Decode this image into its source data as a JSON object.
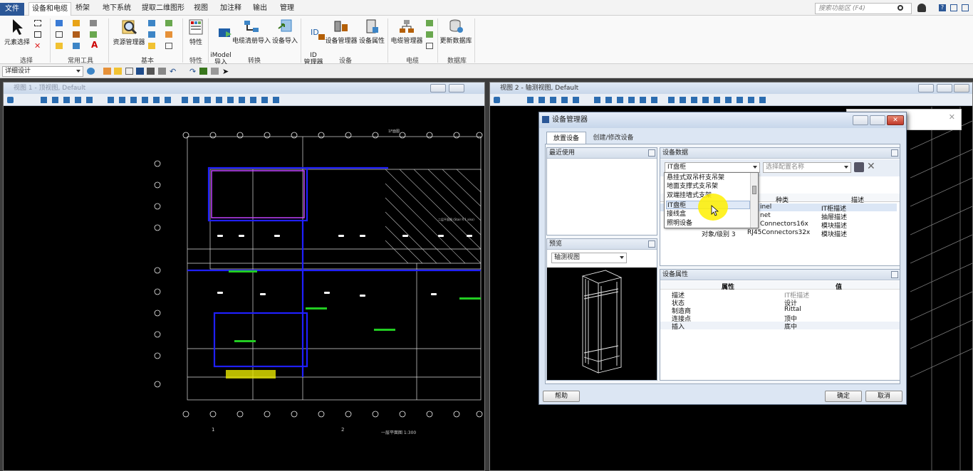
{
  "menubar": {
    "file": "文件",
    "tabs": [
      "设备和电缆",
      "桥架",
      "地下系统",
      "提取二维图形",
      "视图",
      "加注释",
      "输出",
      "管理"
    ],
    "search_placeholder": "搜索功能区 (F4)"
  },
  "ribbon": {
    "element_select": "元素选择",
    "group_select": "选择",
    "group_tools": "常用工具",
    "resource_manager": "资源管理器",
    "group_basic": "基本",
    "properties": "特性",
    "group_properties": "特性",
    "imodel_import": "iModel\n导入",
    "cable_import": "电缆清册导入",
    "device_import": "设备导入",
    "group_convert": "转换",
    "id_manager": "ID\n管理器",
    "device_manager": "设备管理器",
    "device_attr": "设备属性",
    "group_device": "设备",
    "cable_manager": "电缆管理器",
    "group_cable": "电缆",
    "update_db": "更新数据库",
    "group_db": "数据库"
  },
  "quickbar": {
    "workspace": "详细设计"
  },
  "view1": {
    "title": "视图 1 - 顶视图, Default"
  },
  "view2": {
    "title": "视图 2 - 轴测视图, Default"
  },
  "dialog": {
    "title": "设备管理器",
    "tab_place": "放置设备",
    "tab_create": "创建/修改设备",
    "recent": "最近使用",
    "preview": "预览",
    "preview_mode": "轴测视图",
    "device_data": "设备数据",
    "device_combo": "IT盘柜",
    "config_placeholder": "选择配置名称",
    "dropdown_items": [
      "悬挂式双吊杆支吊架",
      "地面支撑式支吊架",
      "双端挂墙式支架",
      "IT盘柜",
      "接线盒",
      "照明设备"
    ],
    "table_headers": [
      "种类",
      "描述"
    ],
    "table_rows": [
      {
        "left": "",
        "kind": "inel",
        "desc": "IT柜描述"
      },
      {
        "left": "",
        "kind": "net",
        "desc": "抽屉描述"
      },
      {
        "left": "",
        "kind": "Connectors16x",
        "desc": "模块描述"
      },
      {
        "left": "对象/级别 3",
        "kind": "RJ45Connectors32x",
        "desc": "模块描述"
      }
    ],
    "props_title": "设备属性",
    "props_headers": [
      "属性",
      "值"
    ],
    "props": [
      {
        "k": "描述",
        "v": "IT柜描述"
      },
      {
        "k": "状态",
        "v": "设计"
      },
      {
        "k": "制造商",
        "v": "Rittal"
      },
      {
        "k": "连接点",
        "v": "顶中"
      },
      {
        "k": "插入",
        "v": "底中"
      }
    ],
    "help": "帮助",
    "ok": "确定",
    "cancel": "取消"
  },
  "drawing": {
    "top_label": "1F面图",
    "bottom_label": "一层平面图  1:300",
    "axis_1": "1",
    "axis_2": "2",
    "wide_note": "二层平面图\n(Stair R.1 also)"
  },
  "colors": {
    "accent": "#2b5797",
    "cad_blue": "#1f1fff",
    "cad_green": "#22cc22",
    "cad_magenta": "#c040ff",
    "cad_yellow": "#e8e800"
  }
}
